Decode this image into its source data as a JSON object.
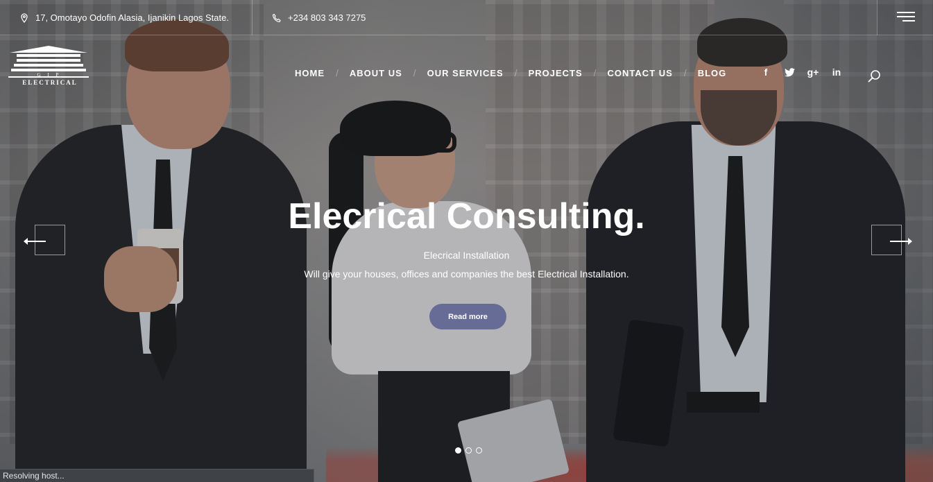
{
  "topbar": {
    "address": "17, Omotayo Odofin Alasia, Ijanikin Lagos State.",
    "phone": "+234 803 343 7275"
  },
  "logo": {
    "sub": "G I P",
    "text": "ELECTRICAL"
  },
  "nav": {
    "items": [
      {
        "label": "HOME"
      },
      {
        "label": "ABOUT US"
      },
      {
        "label": "OUR SERVICES"
      },
      {
        "label": "PROJECTS"
      },
      {
        "label": "CONTACT US"
      },
      {
        "label": "BLOG"
      }
    ],
    "separator": "/"
  },
  "social": {
    "facebook": "f",
    "googleplus": "g+",
    "linkedin": "in"
  },
  "hero": {
    "title": "Elecrical Consulting.",
    "subtitle": "Elecrical Installation",
    "description": "Will give your houses, offices and companies the best Electrical Installation.",
    "button_label": "Read more",
    "button_color": "#676c97",
    "slide_count": 3,
    "active_slide": 1
  },
  "status_bar": "Resolving host..."
}
